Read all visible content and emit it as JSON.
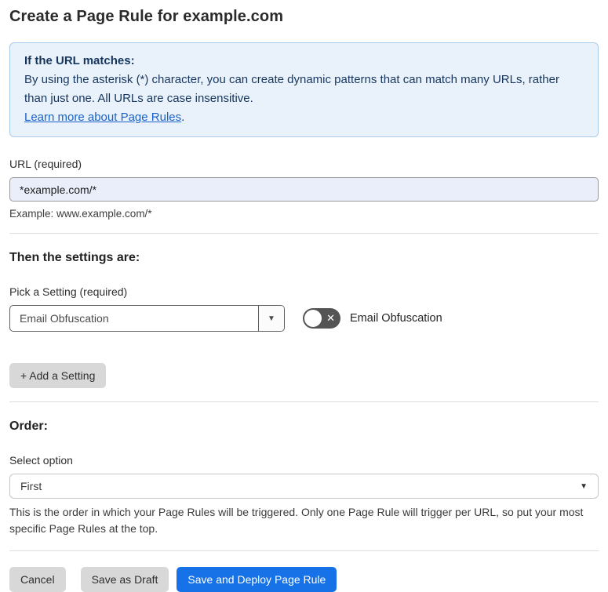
{
  "page": {
    "title": "Create a Page Rule for example.com"
  },
  "info_box": {
    "heading": "If the URL matches:",
    "body": "By using the asterisk (*) character, you can create dynamic patterns that can match many URLs, rather than just one. All URLs are case insensitive.",
    "link_label": "Learn more about Page Rules",
    "link_suffix": "."
  },
  "url_section": {
    "label": "URL (required)",
    "value": "*example.com/*",
    "example": "Example: www.example.com/*"
  },
  "settings_section": {
    "heading": "Then the settings are:",
    "pick_label": "Pick a Setting (required)",
    "selected_setting": "Email Obfuscation",
    "toggle_label": "Email Obfuscation",
    "toggle_state": "off",
    "add_button_label": "+ Add a Setting"
  },
  "order_section": {
    "heading": "Order:",
    "label": "Select option",
    "selected_option": "First",
    "help_text": "This is the order in which your Page Rules will be triggered. Only one Page Rule will trigger per URL, so put your most specific Page Rules at the top."
  },
  "footer": {
    "cancel_label": "Cancel",
    "save_draft_label": "Save as Draft",
    "save_deploy_label": "Save and Deploy Page Rule"
  },
  "icons": {
    "dropdown_caret": "▼",
    "select_caret": "▼",
    "toggle_x": "✕"
  },
  "colors": {
    "accent_blue": "#1672e6",
    "info_box_bg": "#e9f2fb",
    "info_box_border": "#a9cbea",
    "info_text_navy": "#16355c",
    "link_blue": "#1a62c9",
    "url_input_bg": "#e9eefa",
    "gray_button_bg": "#d8d8d8",
    "toggle_off_bg": "#545454",
    "divider": "#dcdcdc"
  }
}
